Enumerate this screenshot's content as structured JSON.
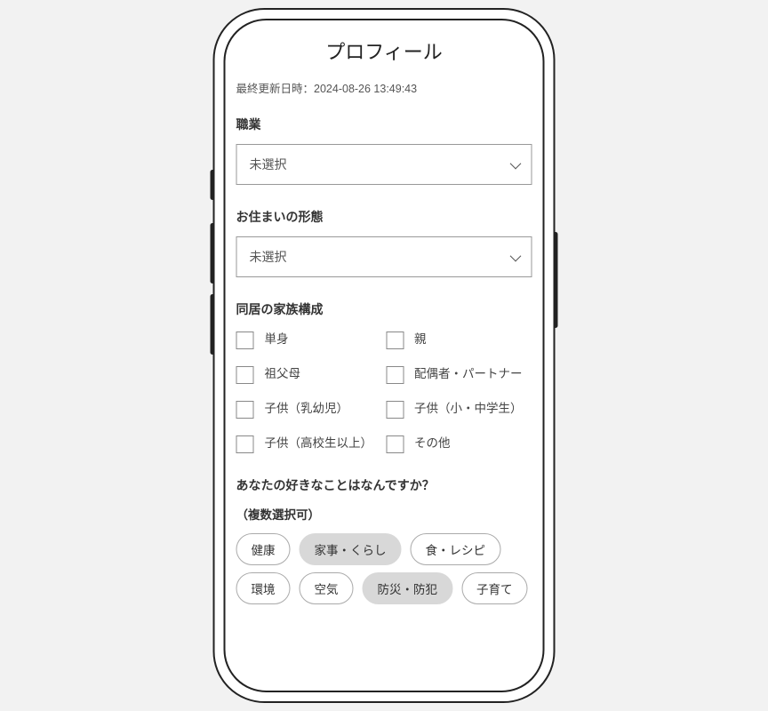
{
  "page": {
    "title": "プロフィール"
  },
  "last_updated": {
    "label": "最終更新日時：",
    "value": "2024-08-26 13:49:43"
  },
  "occupation": {
    "label": "職業",
    "selected": "未選択"
  },
  "residence": {
    "label": "お住まいの形態",
    "selected": "未選択"
  },
  "family": {
    "label": "同居の家族構成",
    "options": [
      "単身",
      "親",
      "祖父母",
      "配偶者・パートナー",
      "子供（乳幼児）",
      "子供（小・中学生）",
      "子供（高校生以上）",
      "その他"
    ]
  },
  "hobbies": {
    "label": "あなたの好きなことはなんですか？",
    "sub": "（複数選択可）",
    "chips": [
      {
        "label": "健康",
        "selected": false
      },
      {
        "label": "家事・くらし",
        "selected": true
      },
      {
        "label": "食・レシピ",
        "selected": false
      },
      {
        "label": "環境",
        "selected": false
      },
      {
        "label": "空気",
        "selected": false
      },
      {
        "label": "防災・防犯",
        "selected": true
      },
      {
        "label": "子育て",
        "selected": false
      }
    ]
  }
}
